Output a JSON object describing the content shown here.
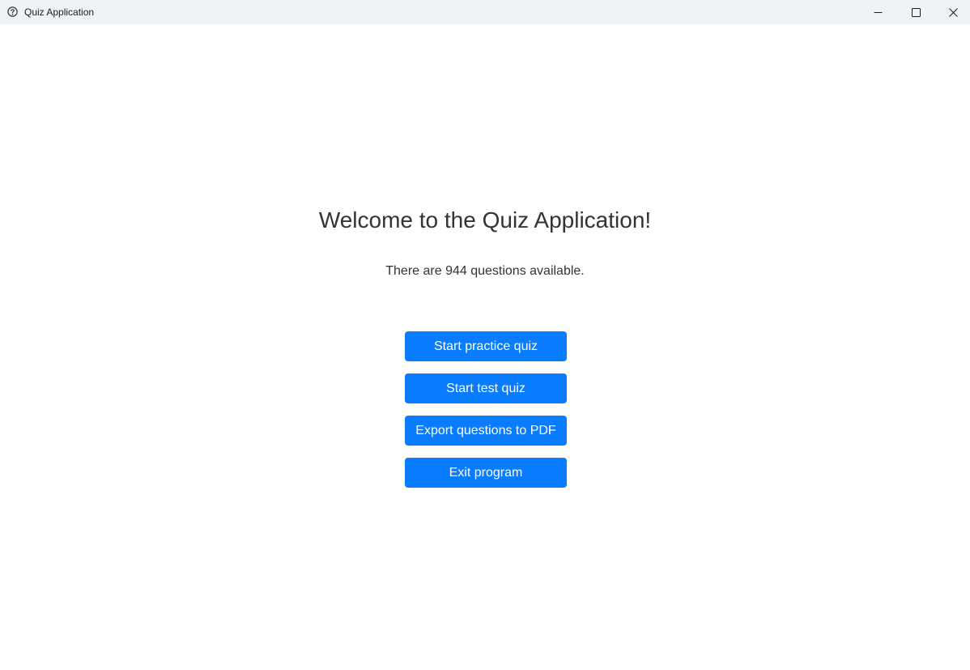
{
  "window": {
    "title": "Quiz Application",
    "app_icon": "quiz-app-icon",
    "controls": {
      "minimize_icon": "minimize-icon",
      "maximize_icon": "maximize-icon",
      "close_icon": "close-icon"
    }
  },
  "main": {
    "heading": "Welcome to the Quiz Application!",
    "question_count_text": "There are 944 questions available.",
    "buttons": {
      "start_practice": "Start practice quiz",
      "start_test": "Start test quiz",
      "export_pdf": "Export questions to PDF",
      "exit": "Exit program"
    }
  },
  "colors": {
    "titlebar_bg": "#eff3f8",
    "button_bg": "#0a7cff",
    "button_text": "#ffffff",
    "text": "#333333"
  }
}
